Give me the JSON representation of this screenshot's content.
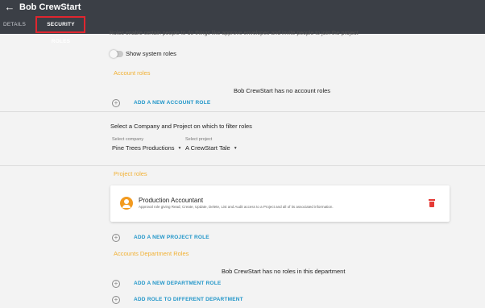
{
  "header": {
    "back_icon": "arrow-left-icon",
    "title": "Bob CrewStart",
    "tabs": [
      {
        "label": "DETAILS",
        "active": false
      },
      {
        "label": "SECURITY ROLES",
        "active": true
      }
    ],
    "highlight_color": "#e0262f"
  },
  "intro_text": "Roles enable certain people to do things like approve envelopes and invite people to join the project",
  "system_roles": {
    "label": "Show system roles",
    "enabled": false
  },
  "account_roles": {
    "title": "Account roles",
    "empty_message": "Bob CrewStart has no account roles",
    "add_label": "ADD A NEW ACCOUNT ROLE"
  },
  "filter": {
    "title": "Select a Company and Project on which to filter roles",
    "company": {
      "label": "Select company",
      "value": "Pine Trees Productions"
    },
    "project": {
      "label": "Select project",
      "value": "A CrewStart Tale"
    }
  },
  "project_roles": {
    "title": "Project roles",
    "items": [
      {
        "name": "Production Accountant",
        "description": "Approval role giving Read, Create, Update, Delete, List and Audit access to a Project and all of its associated information.",
        "avatar_icon": "person-icon",
        "delete_icon": "trash-icon"
      }
    ],
    "add_label": "ADD A NEW PROJECT ROLE"
  },
  "department_roles": {
    "title": "Accounts Department Roles",
    "empty_message": "Bob CrewStart has no roles in this department",
    "add_label": "ADD A NEW DEPARTMENT ROLE",
    "add_other_label": "ADD ROLE TO DIFFERENT DEPARTMENT"
  },
  "colors": {
    "header_bg": "#3b3f46",
    "section_title": "#f2b134",
    "link": "#2196c9",
    "avatar": "#f29a1f",
    "delete": "#e53935"
  }
}
